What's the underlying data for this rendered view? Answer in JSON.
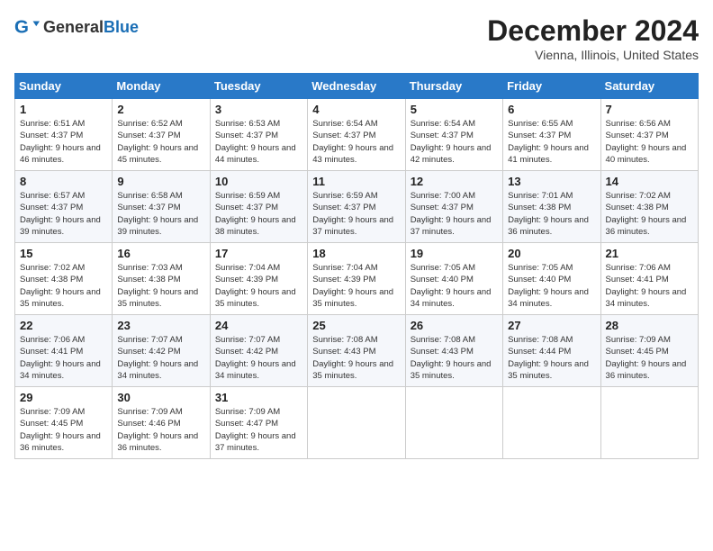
{
  "header": {
    "logo_general": "General",
    "logo_blue": "Blue",
    "month_title": "December 2024",
    "location": "Vienna, Illinois, United States"
  },
  "days_of_week": [
    "Sunday",
    "Monday",
    "Tuesday",
    "Wednesday",
    "Thursday",
    "Friday",
    "Saturday"
  ],
  "weeks": [
    [
      {
        "day": "1",
        "sunrise": "6:51 AM",
        "sunset": "4:37 PM",
        "daylight": "9 hours and 46 minutes."
      },
      {
        "day": "2",
        "sunrise": "6:52 AM",
        "sunset": "4:37 PM",
        "daylight": "9 hours and 45 minutes."
      },
      {
        "day": "3",
        "sunrise": "6:53 AM",
        "sunset": "4:37 PM",
        "daylight": "9 hours and 44 minutes."
      },
      {
        "day": "4",
        "sunrise": "6:54 AM",
        "sunset": "4:37 PM",
        "daylight": "9 hours and 43 minutes."
      },
      {
        "day": "5",
        "sunrise": "6:54 AM",
        "sunset": "4:37 PM",
        "daylight": "9 hours and 42 minutes."
      },
      {
        "day": "6",
        "sunrise": "6:55 AM",
        "sunset": "4:37 PM",
        "daylight": "9 hours and 41 minutes."
      },
      {
        "day": "7",
        "sunrise": "6:56 AM",
        "sunset": "4:37 PM",
        "daylight": "9 hours and 40 minutes."
      }
    ],
    [
      {
        "day": "8",
        "sunrise": "6:57 AM",
        "sunset": "4:37 PM",
        "daylight": "9 hours and 39 minutes."
      },
      {
        "day": "9",
        "sunrise": "6:58 AM",
        "sunset": "4:37 PM",
        "daylight": "9 hours and 39 minutes."
      },
      {
        "day": "10",
        "sunrise": "6:59 AM",
        "sunset": "4:37 PM",
        "daylight": "9 hours and 38 minutes."
      },
      {
        "day": "11",
        "sunrise": "6:59 AM",
        "sunset": "4:37 PM",
        "daylight": "9 hours and 37 minutes."
      },
      {
        "day": "12",
        "sunrise": "7:00 AM",
        "sunset": "4:37 PM",
        "daylight": "9 hours and 37 minutes."
      },
      {
        "day": "13",
        "sunrise": "7:01 AM",
        "sunset": "4:38 PM",
        "daylight": "9 hours and 36 minutes."
      },
      {
        "day": "14",
        "sunrise": "7:02 AM",
        "sunset": "4:38 PM",
        "daylight": "9 hours and 36 minutes."
      }
    ],
    [
      {
        "day": "15",
        "sunrise": "7:02 AM",
        "sunset": "4:38 PM",
        "daylight": "9 hours and 35 minutes."
      },
      {
        "day": "16",
        "sunrise": "7:03 AM",
        "sunset": "4:38 PM",
        "daylight": "9 hours and 35 minutes."
      },
      {
        "day": "17",
        "sunrise": "7:04 AM",
        "sunset": "4:39 PM",
        "daylight": "9 hours and 35 minutes."
      },
      {
        "day": "18",
        "sunrise": "7:04 AM",
        "sunset": "4:39 PM",
        "daylight": "9 hours and 35 minutes."
      },
      {
        "day": "19",
        "sunrise": "7:05 AM",
        "sunset": "4:40 PM",
        "daylight": "9 hours and 34 minutes."
      },
      {
        "day": "20",
        "sunrise": "7:05 AM",
        "sunset": "4:40 PM",
        "daylight": "9 hours and 34 minutes."
      },
      {
        "day": "21",
        "sunrise": "7:06 AM",
        "sunset": "4:41 PM",
        "daylight": "9 hours and 34 minutes."
      }
    ],
    [
      {
        "day": "22",
        "sunrise": "7:06 AM",
        "sunset": "4:41 PM",
        "daylight": "9 hours and 34 minutes."
      },
      {
        "day": "23",
        "sunrise": "7:07 AM",
        "sunset": "4:42 PM",
        "daylight": "9 hours and 34 minutes."
      },
      {
        "day": "24",
        "sunrise": "7:07 AM",
        "sunset": "4:42 PM",
        "daylight": "9 hours and 34 minutes."
      },
      {
        "day": "25",
        "sunrise": "7:08 AM",
        "sunset": "4:43 PM",
        "daylight": "9 hours and 35 minutes."
      },
      {
        "day": "26",
        "sunrise": "7:08 AM",
        "sunset": "4:43 PM",
        "daylight": "9 hours and 35 minutes."
      },
      {
        "day": "27",
        "sunrise": "7:08 AM",
        "sunset": "4:44 PM",
        "daylight": "9 hours and 35 minutes."
      },
      {
        "day": "28",
        "sunrise": "7:09 AM",
        "sunset": "4:45 PM",
        "daylight": "9 hours and 36 minutes."
      }
    ],
    [
      {
        "day": "29",
        "sunrise": "7:09 AM",
        "sunset": "4:45 PM",
        "daylight": "9 hours and 36 minutes."
      },
      {
        "day": "30",
        "sunrise": "7:09 AM",
        "sunset": "4:46 PM",
        "daylight": "9 hours and 36 minutes."
      },
      {
        "day": "31",
        "sunrise": "7:09 AM",
        "sunset": "4:47 PM",
        "daylight": "9 hours and 37 minutes."
      },
      null,
      null,
      null,
      null
    ]
  ],
  "labels": {
    "sunrise": "Sunrise:",
    "sunset": "Sunset:",
    "daylight": "Daylight:"
  }
}
